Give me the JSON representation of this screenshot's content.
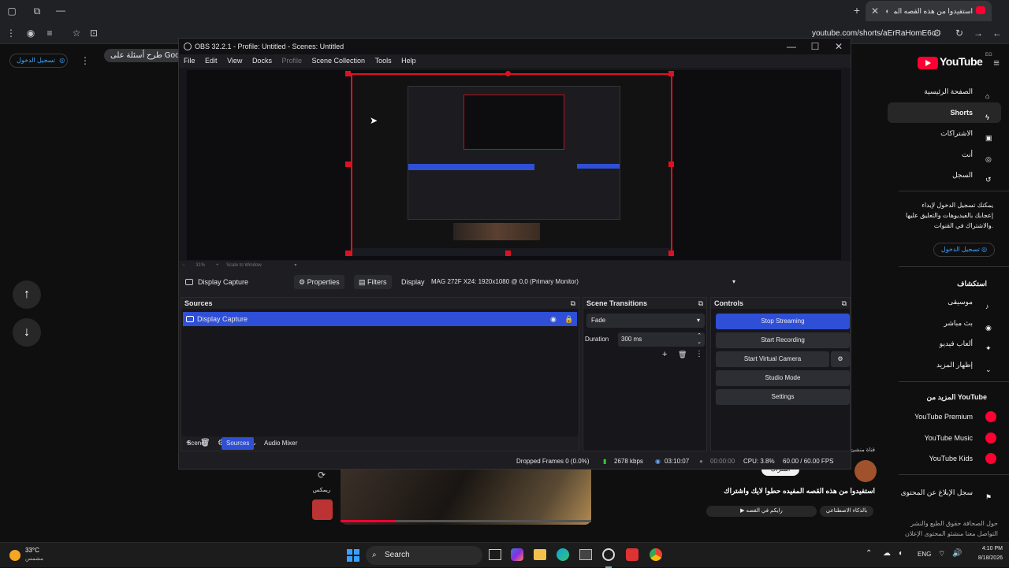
{
  "browser": {
    "tab_title": "استفيدوا من هذه القصه المفد",
    "url": "youtube.com/shorts/aErRaHomE6c",
    "search_chip": "طرح أسئلة على Google"
  },
  "youtube": {
    "logo_text": "YouTube",
    "logo_region": "EG",
    "signin_label": "تسجيل الدخول",
    "nav": [
      {
        "label": "الصفحة الرئيسية",
        "icon": "home-icon"
      },
      {
        "label": "Shorts",
        "icon": "shorts-icon"
      },
      {
        "label": "الاشتراكات",
        "icon": "subscriptions-icon"
      },
      {
        "label": "أنت",
        "icon": "user-icon"
      },
      {
        "label": "السجل",
        "icon": "history-icon"
      }
    ],
    "signin_prompt": "يمكنك تسجيل الدخول لإبداء إعجابك بالفيديوهات والتعليق عليها والاشتراك في القنوات.",
    "explore_title": "استكشاف",
    "explore": [
      {
        "label": "موسيقى",
        "icon": "music-icon"
      },
      {
        "label": "بث مباشر",
        "icon": "live-icon"
      },
      {
        "label": "ألعاب فيديو",
        "icon": "gaming-icon"
      },
      {
        "label": "إظهار المزيد",
        "icon": "chevron-down-icon"
      }
    ],
    "more_title": "المزيد من YouTube",
    "more": [
      {
        "label": "YouTube Premium"
      },
      {
        "label": "YouTube Music"
      },
      {
        "label": "YouTube Kids"
      }
    ],
    "report_label": "سجل الإبلاغ عن المحتوى",
    "footer_line1": "حول  الصحافة  حقوق الطبع والنشر",
    "footer_line2": "التواصل معنا  منشئو المحتوى  الإعلان",
    "short": {
      "title": "استفيدوا من هذه القصه المفيده حطوا لايك واشتراك",
      "channel_hint": "قناة منشئ",
      "music_label": "بالذكاء الاصطناعي",
      "music_track": "رايكم في القصه",
      "subscribe_label": "اشتراك",
      "remix_label": "ريمكس"
    }
  },
  "obs": {
    "title": "OBS 32.2.1 - Profile: Untitled - Scenes: Untitled",
    "menu": [
      "File",
      "Edit",
      "View",
      "Docks",
      "Profile",
      "Scene Collection",
      "Tools",
      "Help"
    ],
    "zoom_label": "31%",
    "scale_label": "Scale to Window",
    "source_name": "Display Capture",
    "properties_label": "Properties",
    "filters_label": "Filters",
    "display_label": "Display",
    "display_value": "MAG 272F X24: 1920x1080 @ 0,0 (Primary Monitor)",
    "sources_title": "Sources",
    "sources": [
      "Display Capture"
    ],
    "transitions_title": "Scene Transitions",
    "transition": "Fade",
    "duration_label": "Duration",
    "duration_value": "300 ms",
    "controls_title": "Controls",
    "controls": {
      "stop_streaming": "Stop Streaming",
      "start_recording": "Start Recording",
      "start_virtual_camera": "Start Virtual Camera",
      "studio_mode": "Studio Mode",
      "settings": "Settings"
    },
    "dock_tabs": [
      "Scenes",
      "Sources",
      "Audio Mixer"
    ],
    "active_dock_tab": 1,
    "status": {
      "dropped_frames": "Dropped Frames 0 (0.0%)",
      "bitrate": "2678 kbps",
      "stream_time": "03:10:07",
      "record_time": "00:00:00",
      "cpu": "CPU: 3.8%",
      "fps": "60.00 / 60.00 FPS"
    },
    "accent": "#2f4fd6"
  },
  "taskbar": {
    "temp": "33°C",
    "weather": "مشمس",
    "search_label": "Search",
    "lang": "ENG",
    "time": "4:10 PM",
    "date": "8/18/2026"
  }
}
